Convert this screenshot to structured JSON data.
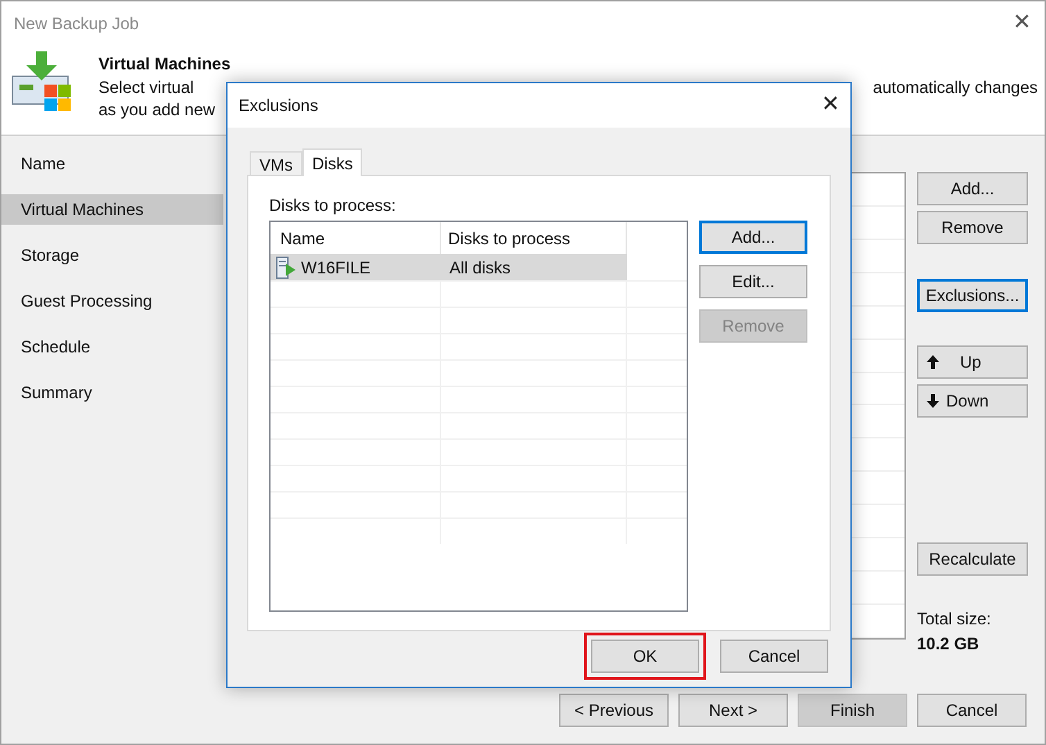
{
  "window": {
    "title": "New Backup Job",
    "close": "✕"
  },
  "header": {
    "title": "Virtual Machines",
    "description_line_1_start": "Select virtual",
    "description_line_1_end": "automatically changes",
    "description_line_2": "as you add new"
  },
  "sidebar": {
    "items": [
      {
        "label": "Name",
        "selected": false
      },
      {
        "label": "Virtual Machines",
        "selected": true
      },
      {
        "label": "Storage",
        "selected": false
      },
      {
        "label": "Guest Processing",
        "selected": false
      },
      {
        "label": "Schedule",
        "selected": false
      },
      {
        "label": "Summary",
        "selected": false
      }
    ]
  },
  "side_buttons": [
    {
      "label": "Add...",
      "kind": "text",
      "focused": false
    },
    {
      "label": "Remove",
      "kind": "text",
      "focused": false
    },
    {
      "label": "Exclusions...",
      "kind": "text",
      "focused": true
    },
    {
      "label": "Up",
      "kind": "arrow-up",
      "focused": false
    },
    {
      "label": "Down",
      "kind": "arrow-down",
      "focused": false
    },
    {
      "label": "Recalculate",
      "kind": "text",
      "focused": false
    }
  ],
  "total_size": {
    "label": "Total size:",
    "value": "10.2 GB"
  },
  "wizard_buttons": [
    {
      "label": "< Previous",
      "disabled": false
    },
    {
      "label": "Next >",
      "disabled": false
    },
    {
      "label": "Finish",
      "disabled": true
    },
    {
      "label": "Cancel",
      "disabled": false
    }
  ],
  "dialog": {
    "title": "Exclusions",
    "close": "✕",
    "tabs": [
      {
        "label": "VMs",
        "selected": false
      },
      {
        "label": "Disks",
        "selected": true
      }
    ],
    "list_label": "Disks to process:",
    "table": {
      "columns": [
        "Name",
        "Disks to process"
      ],
      "rows": [
        {
          "name": "W16FILE",
          "disks": "All disks",
          "selected": true
        }
      ]
    },
    "buttons": [
      {
        "label": "Add...",
        "focused": true,
        "disabled": false
      },
      {
        "label": "Edit...",
        "focused": false,
        "disabled": false
      },
      {
        "label": "Remove",
        "focused": false,
        "disabled": true
      }
    ],
    "footer_buttons": [
      {
        "label": "OK",
        "highlighted": true
      },
      {
        "label": "Cancel",
        "highlighted": false
      }
    ]
  }
}
